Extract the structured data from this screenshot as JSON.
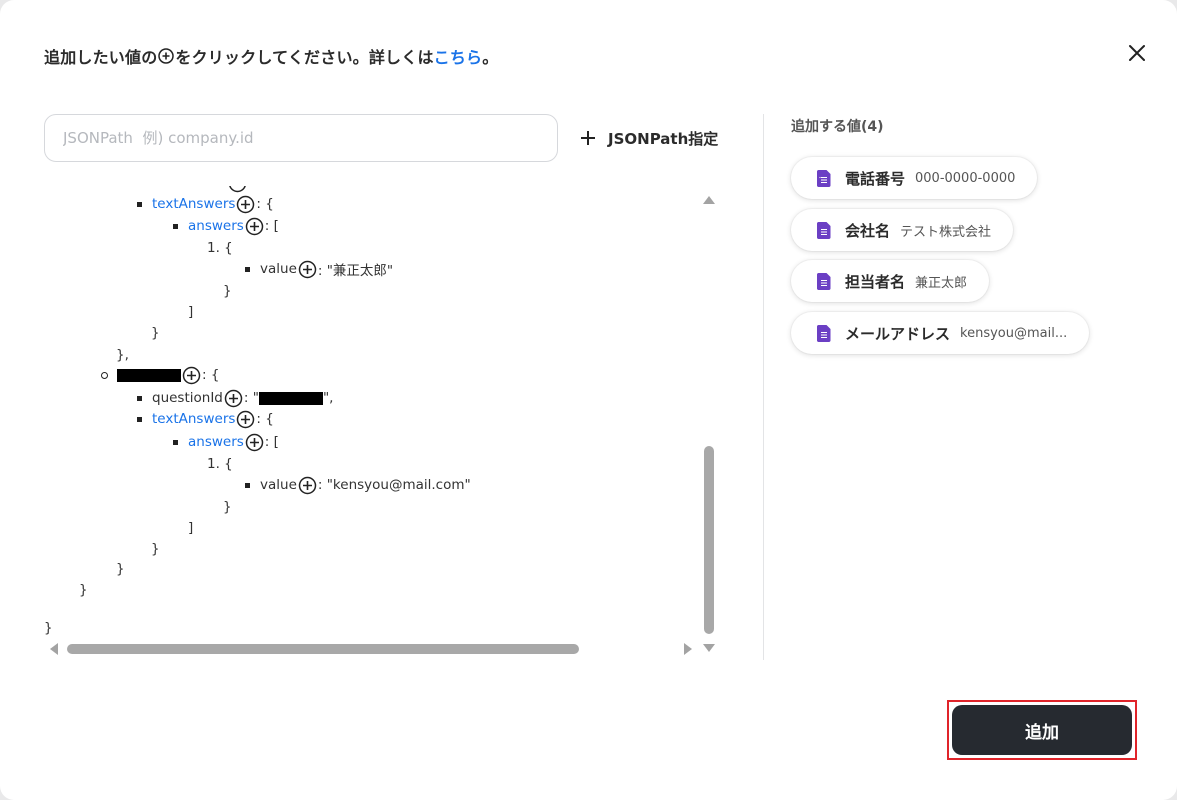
{
  "header": {
    "text_before": "追加したい値の",
    "text_after": "をクリックしてください。詳しくは",
    "link": "こちら",
    "text_end": "。"
  },
  "search": {
    "placeholder": "JSONPath  例) company.id"
  },
  "jsonpath_button": {
    "label": "JSONPath指定"
  },
  "tree": {
    "lines": [
      {
        "key": "textAnswers",
        "key_is_link": true,
        "suffix": ": {"
      },
      {
        "key": "answers",
        "key_is_link": true,
        "suffix": ": ["
      },
      {
        "text": "1. {"
      },
      {
        "key": "value",
        "key_is_link": false,
        "suffix": ": \"兼正太郎\""
      },
      {
        "text": "}"
      },
      {
        "text": "]"
      },
      {
        "text": "}"
      },
      {
        "text": "},"
      },
      {
        "suffix": ": {"
      },
      {
        "key": "questionId",
        "key_is_link": false,
        "suffix_before": ": \"",
        "suffix_after": "\","
      },
      {
        "key": "textAnswers",
        "key_is_link": true,
        "suffix": ": {"
      },
      {
        "key": "answers",
        "key_is_link": true,
        "suffix": ": ["
      },
      {
        "text": "1. {"
      },
      {
        "key": "value",
        "key_is_link": false,
        "suffix": ": \"kensyou@mail.com\""
      },
      {
        "text": "}"
      },
      {
        "text": "]"
      },
      {
        "text": "}"
      },
      {
        "text": "}"
      },
      {
        "text": "}"
      },
      {
        "text": "}"
      }
    ]
  },
  "values_panel": {
    "title": "追加する値(4)",
    "chips": [
      {
        "label": "電話番号",
        "value": "000-0000-0000"
      },
      {
        "label": "会社名",
        "value": "テスト株式会社"
      },
      {
        "label": "担当者名",
        "value": "兼正太郎"
      },
      {
        "label": "メールアドレス",
        "value": "kensyou@mail..."
      }
    ]
  },
  "add_button": {
    "label": "追加"
  },
  "colors": {
    "link": "#1a73e8",
    "button_bg": "#262a30",
    "highlight_border": "#e0242a",
    "doc_icon": "#6b3fc4"
  }
}
